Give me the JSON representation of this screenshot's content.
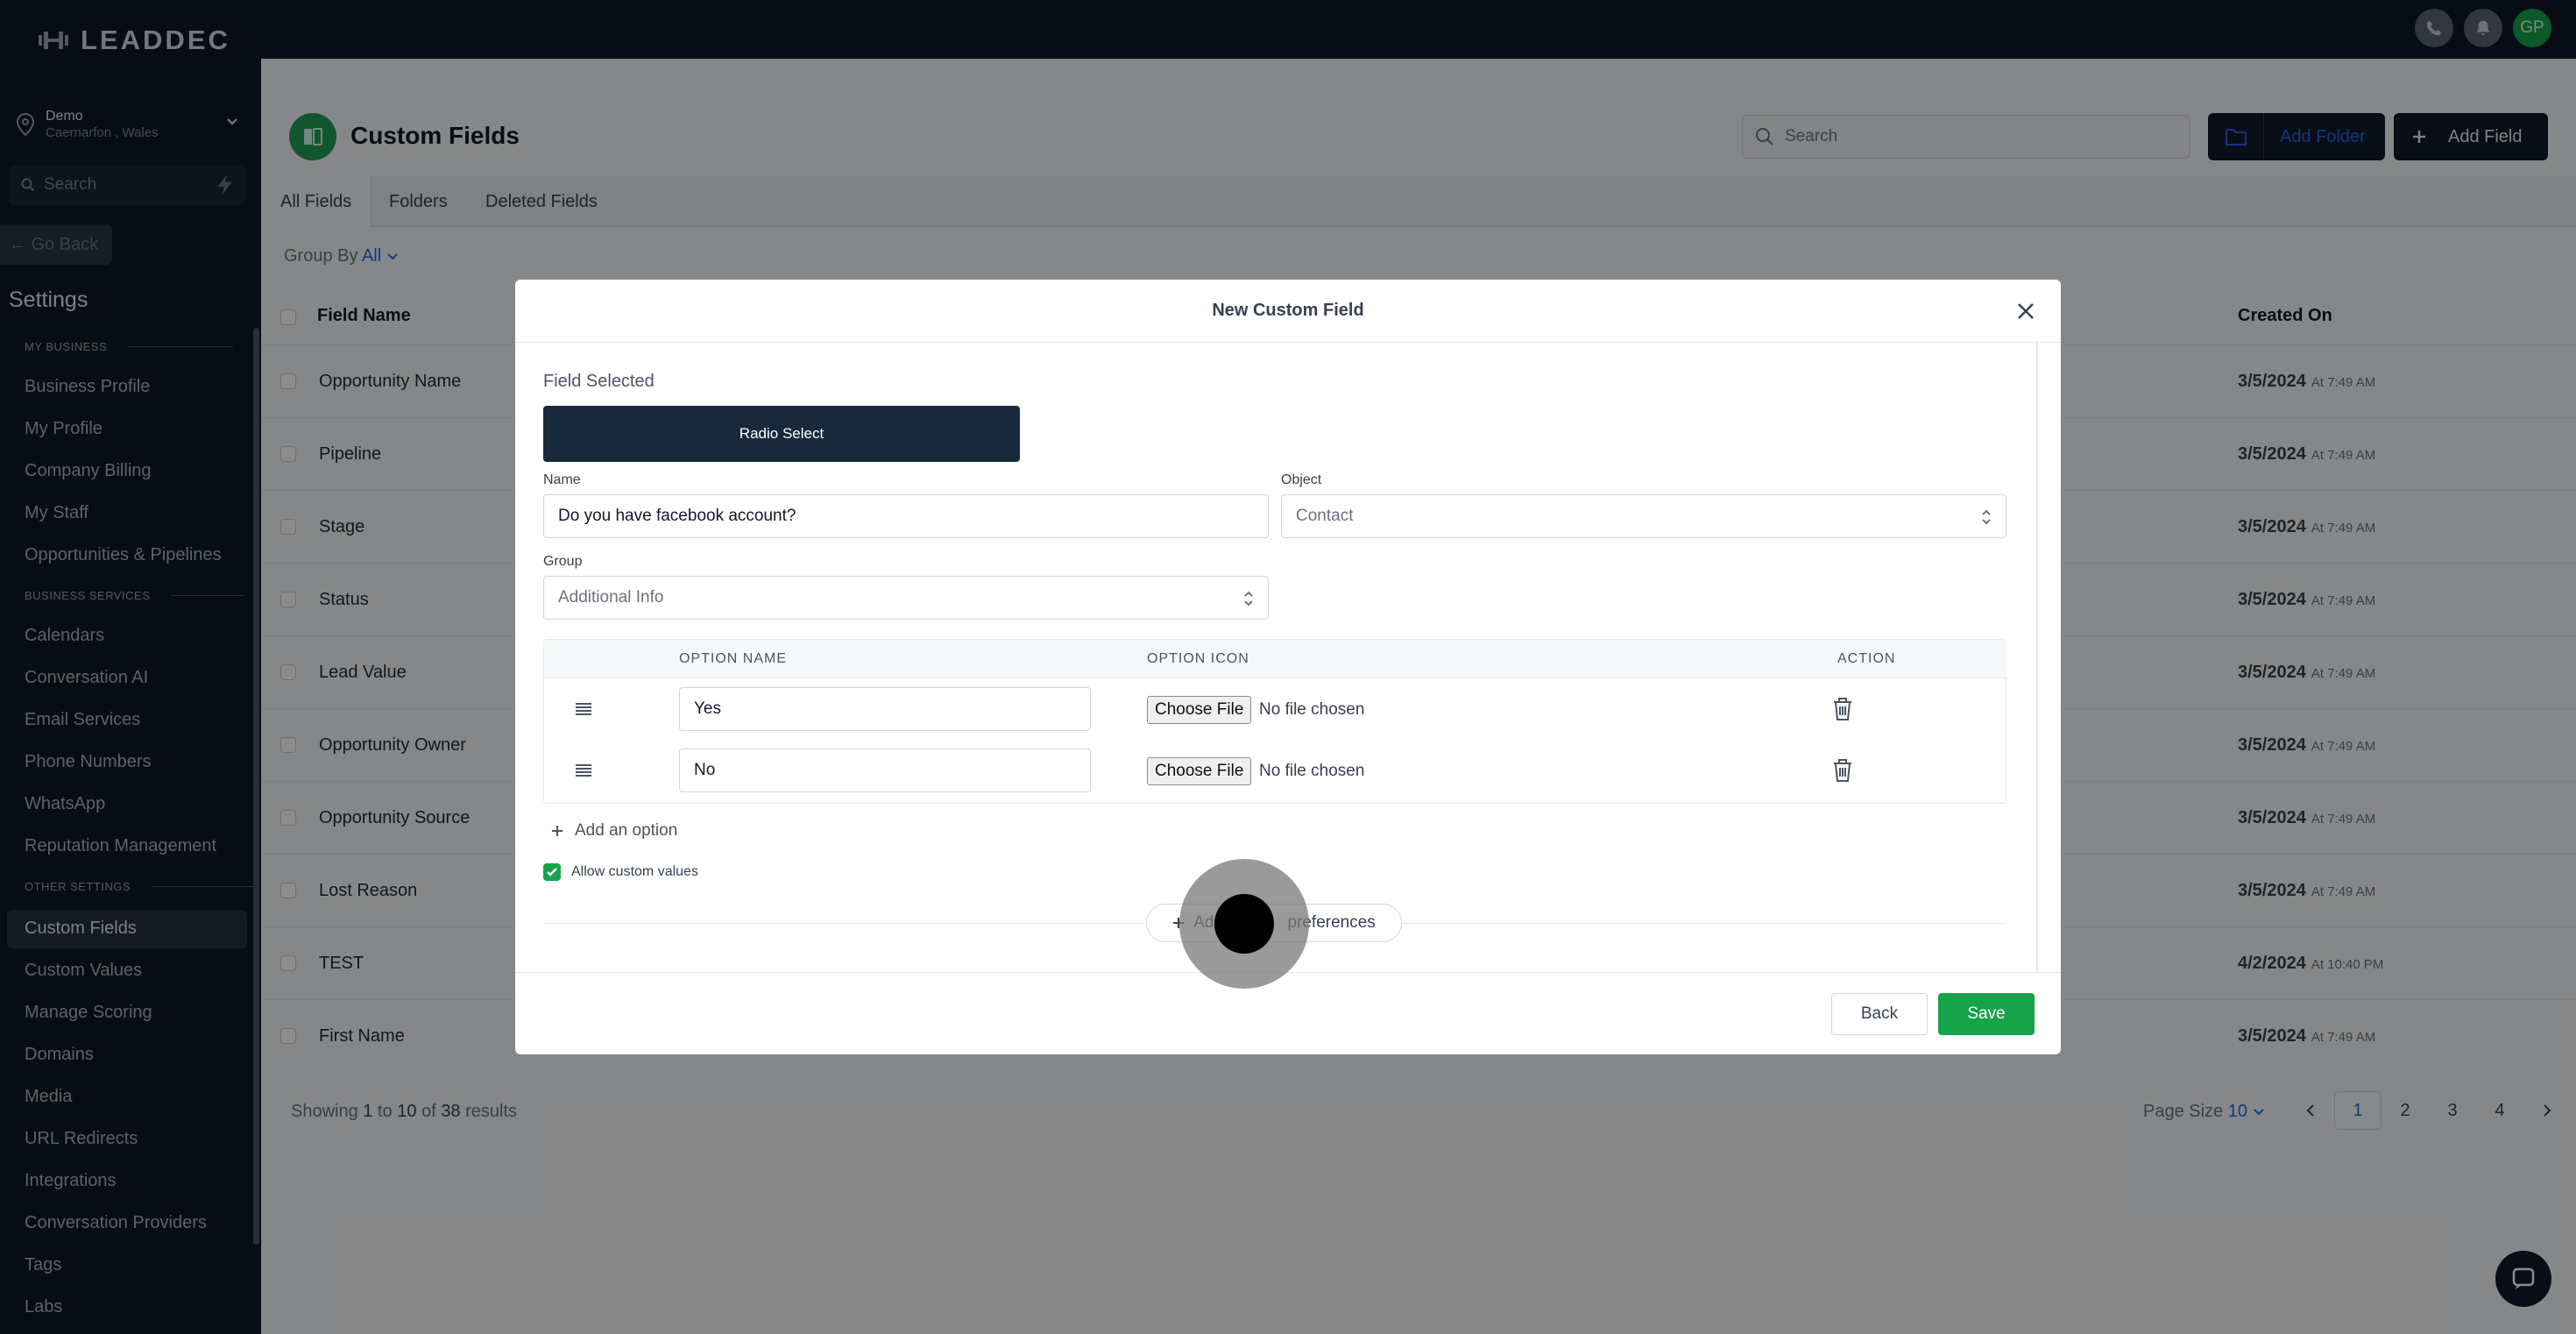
{
  "brand": {
    "name": "LEADDEC"
  },
  "topbar": {
    "avatar_initials": "GP"
  },
  "sidebar": {
    "location_name": "Demo",
    "location_sub": "Caernarfon , Wales",
    "search_placeholder": "Search",
    "go_back": "← Go Back",
    "settings_title": "Settings",
    "sections": [
      {
        "label": "MY BUSINESS",
        "items": [
          "Business Profile",
          "My Profile",
          "Company Billing",
          "My Staff",
          "Opportunities & Pipelines"
        ]
      },
      {
        "label": "BUSINESS SERVICES",
        "items": [
          "Calendars",
          "Conversation AI",
          "Email Services",
          "Phone Numbers",
          "WhatsApp",
          "Reputation Management"
        ]
      },
      {
        "label": "OTHER SETTINGS",
        "items": [
          "Custom Fields",
          "Custom Values",
          "Manage Scoring",
          "Domains",
          "Media",
          "URL Redirects",
          "Integrations",
          "Conversation Providers",
          "Tags",
          "Labs"
        ]
      }
    ],
    "active_item": "Custom Fields"
  },
  "main": {
    "title": "Custom Fields",
    "search_placeholder": "Search",
    "add_folder": "Add Folder",
    "add_field": "Add Field",
    "tabs": [
      {
        "label": "All Fields",
        "active": true
      },
      {
        "label": "Folders",
        "active": false
      },
      {
        "label": "Deleted Fields",
        "active": false
      }
    ],
    "group_by_label": "Group By",
    "group_by_value": "All",
    "columns": {
      "field_name": "Field Name",
      "created_on": "Created On"
    },
    "rows": [
      {
        "name": "Opportunity Name",
        "date": "3/5/2024",
        "time": "At 7:49 AM"
      },
      {
        "name": "Pipeline",
        "date": "3/5/2024",
        "time": "At 7:49 AM"
      },
      {
        "name": "Stage",
        "date": "3/5/2024",
        "time": "At 7:49 AM"
      },
      {
        "name": "Status",
        "date": "3/5/2024",
        "time": "At 7:49 AM"
      },
      {
        "name": "Lead Value",
        "date": "3/5/2024",
        "time": "At 7:49 AM"
      },
      {
        "name": "Opportunity Owner",
        "date": "3/5/2024",
        "time": "At 7:49 AM"
      },
      {
        "name": "Opportunity Source",
        "date": "3/5/2024",
        "time": "At 7:49 AM"
      },
      {
        "name": "Lost Reason",
        "date": "3/5/2024",
        "time": "At 7:49 AM"
      },
      {
        "name": "TEST",
        "date": "4/2/2024",
        "time": "At 10:40 PM"
      },
      {
        "name": "First Name",
        "date": "3/5/2024",
        "time": "At 7:49 AM"
      }
    ],
    "showing": {
      "prefix": "Showing",
      "from": "1",
      "to_word": "to",
      "to": "10",
      "of_word": "of",
      "total": "38",
      "suffix": "results"
    },
    "page_size_label": "Page Size",
    "page_size_value": "10",
    "pages": [
      "1",
      "2",
      "3",
      "4"
    ],
    "current_page": "1"
  },
  "modal": {
    "title": "New Custom Field",
    "field_selected_label": "Field Selected",
    "field_type": "Radio Select",
    "name_label": "Name",
    "name_value": "Do you have facebook account?",
    "object_label": "Object",
    "object_value": "Contact",
    "group_label": "Group",
    "group_value": "Additional Info",
    "options_table": {
      "col_name": "OPTION NAME",
      "col_icon": "OPTION ICON",
      "col_action": "ACTION",
      "rows": [
        {
          "name": "Yes",
          "file_button": "Choose File",
          "file_status": "No file chosen"
        },
        {
          "name": "No",
          "file_button": "Choose File",
          "file_status": "No file chosen"
        }
      ]
    },
    "add_option": "Add an option",
    "allow_custom_label": "Allow custom values",
    "allow_custom_checked": true,
    "preferences_button_left": "Ad",
    "preferences_button_right": "preferences",
    "back_button": "Back",
    "save_button": "Save"
  },
  "colors": {
    "accent_green": "#16a34a",
    "dark_navy": "#111827",
    "link_blue": "#2563eb",
    "chip_navy": "#17293b"
  }
}
